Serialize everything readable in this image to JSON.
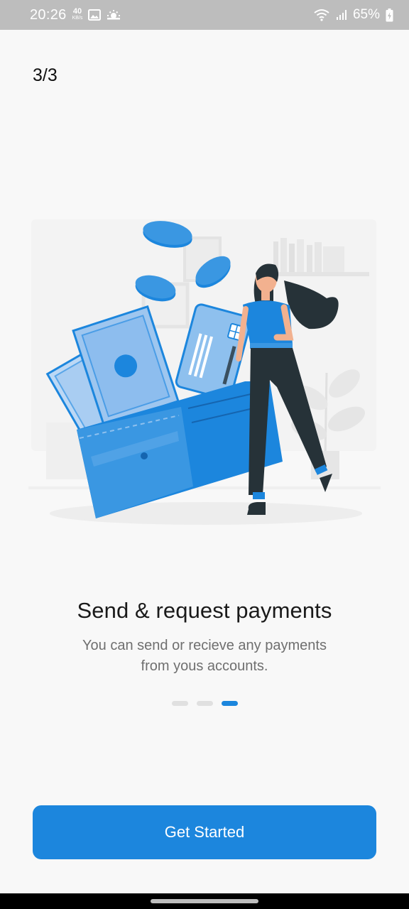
{
  "status_bar": {
    "time": "20:26",
    "net_speed_value": "40",
    "net_speed_unit": "KB/s",
    "battery": "65%",
    "icons": [
      "image-icon",
      "weather-icon",
      "wifi-icon",
      "signal-icon",
      "battery-icon"
    ]
  },
  "onboarding": {
    "page_counter": "3/3",
    "title": "Send & request payments",
    "subtitle": "You can send or recieve any payments from yous accounts.",
    "pages_total": 3,
    "active_page": 3,
    "cta_label": "Get Started"
  },
  "colors": {
    "accent": "#1c86dd",
    "background": "#f8f8f8",
    "status_bar": "#bdbdbd",
    "text_primary": "#1a1a1a",
    "text_secondary": "#6f6f6f"
  }
}
